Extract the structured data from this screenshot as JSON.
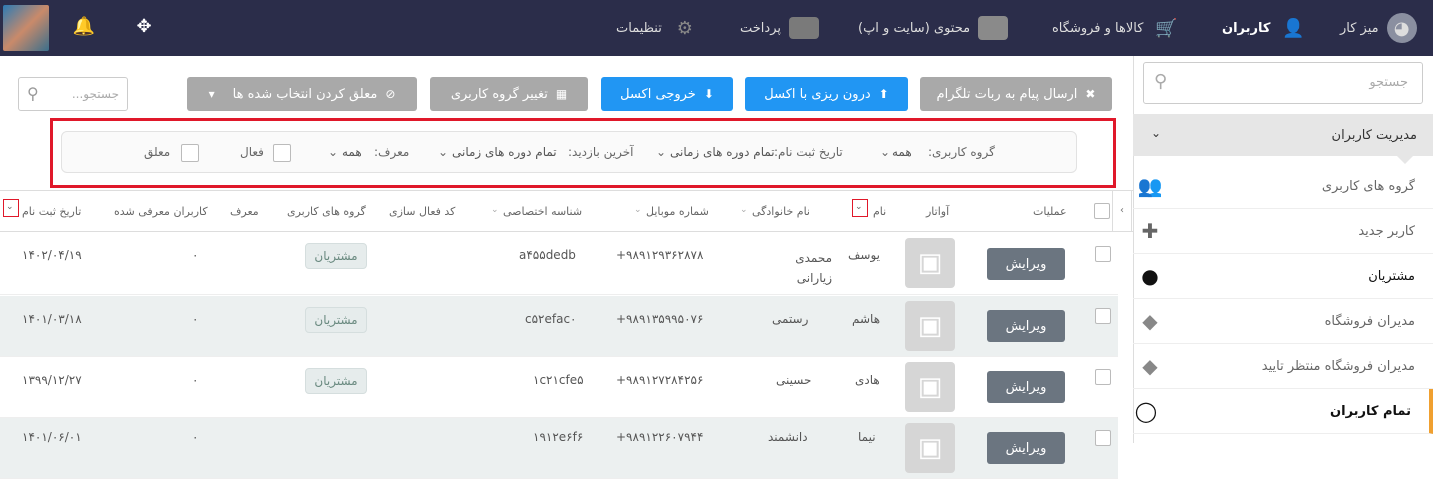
{
  "topbar": {
    "nav": [
      {
        "label": "میز کار",
        "icon": "dashboard-icon"
      },
      {
        "label": "کاربران",
        "icon": "users-icon"
      },
      {
        "label": "کالاها و فروشگاه",
        "icon": "cart-icon"
      },
      {
        "label": "محتوی (سایت و اپ)",
        "icon": "folder-icon"
      },
      {
        "label": "پرداخت",
        "icon": "credit-card-icon"
      },
      {
        "label": "تنظیمات",
        "icon": "gear-icon"
      }
    ]
  },
  "sidebar": {
    "search_placeholder": "جستجو",
    "section_title": "مدیریت کاربران",
    "items": [
      {
        "label": "گروه های کاربری",
        "icon": "user-group-icon"
      },
      {
        "label": "کاربر جدید",
        "icon": "add-user-icon"
      },
      {
        "label": "مشتریان",
        "icon": "customer-icon"
      },
      {
        "label": "مدیران فروشگاه",
        "icon": "spy-icon"
      },
      {
        "label": "مدیران فروشگاه منتظر تایید",
        "icon": "spy-icon"
      },
      {
        "label": "تمام کاربران",
        "icon": "user-outline-icon"
      }
    ]
  },
  "toolbar": {
    "telegram": "ارسال پیام به ربات تلگرام",
    "import_excel": "درون ریزی با اکسل",
    "export_excel": "خروجی اکسل",
    "change_group": "تغییر گروه کاربری",
    "suspend_selected": "معلق کردن انتخاب شده ها",
    "search_placeholder": "جستجو..."
  },
  "filters": {
    "group_label": "گروه کاربری:",
    "group_value": "همه",
    "reg_date_label": "تاریخ ثبت نام:",
    "reg_date_value": "تمام دوره های زمانی",
    "last_visit_label": "آخرین بازدید:",
    "last_visit_value": "تمام دوره های زمانی",
    "referrer_label": "معرف:",
    "referrer_value": "همه",
    "active_label": "فعال",
    "suspended_label": "معلق"
  },
  "table": {
    "headers": {
      "operations": "عملیات",
      "avatar": "آواتار",
      "name": "نام",
      "family": "نام خانوادگی",
      "mobile": "شماره موبایل",
      "special_id": "شناسه اختصاصی",
      "activation": "کد فعال سازی",
      "groups": "گروه های کاربری",
      "referrer": "معرف",
      "referred_users": "کاربران معرفی شده",
      "reg_date": "تاریخ ثبت نام"
    },
    "edit_label": "ویرایش",
    "rows": [
      {
        "name": "یوسف",
        "family": "محمدی زیارانی",
        "mobile": "+۹۸۹۱۲۹۳۶۲۸۷۸",
        "special_id": "a۴۵۵dedb",
        "group": "مشتریان",
        "referred": "۰",
        "date": "۱۴۰۲/۰۴/۱۹"
      },
      {
        "name": "هاشم",
        "family": "رستمی",
        "mobile": "+۹۸۹۱۳۵۹۹۵۰۷۶",
        "special_id": "c۵۲efac۰",
        "group": "مشتریان",
        "referred": "۰",
        "date": "۱۴۰۱/۰۳/۱۸"
      },
      {
        "name": "هادی",
        "family": "حسینی",
        "mobile": "+۹۸۹۱۲۷۲۸۴۲۵۶",
        "special_id": "۱c۲۱cfe۵",
        "group": "مشتریان",
        "referred": "۰",
        "date": "۱۳۹۹/۱۲/۲۷"
      },
      {
        "name": "نیما",
        "family": "دانشمند",
        "mobile": "+۹۸۹۱۲۲۶۰۷۹۴۴",
        "special_id": "۱۹۱۲e۶f۶",
        "group": "",
        "referred": "۰",
        "date": "۱۴۰۱/۰۶/۰۱"
      }
    ]
  }
}
